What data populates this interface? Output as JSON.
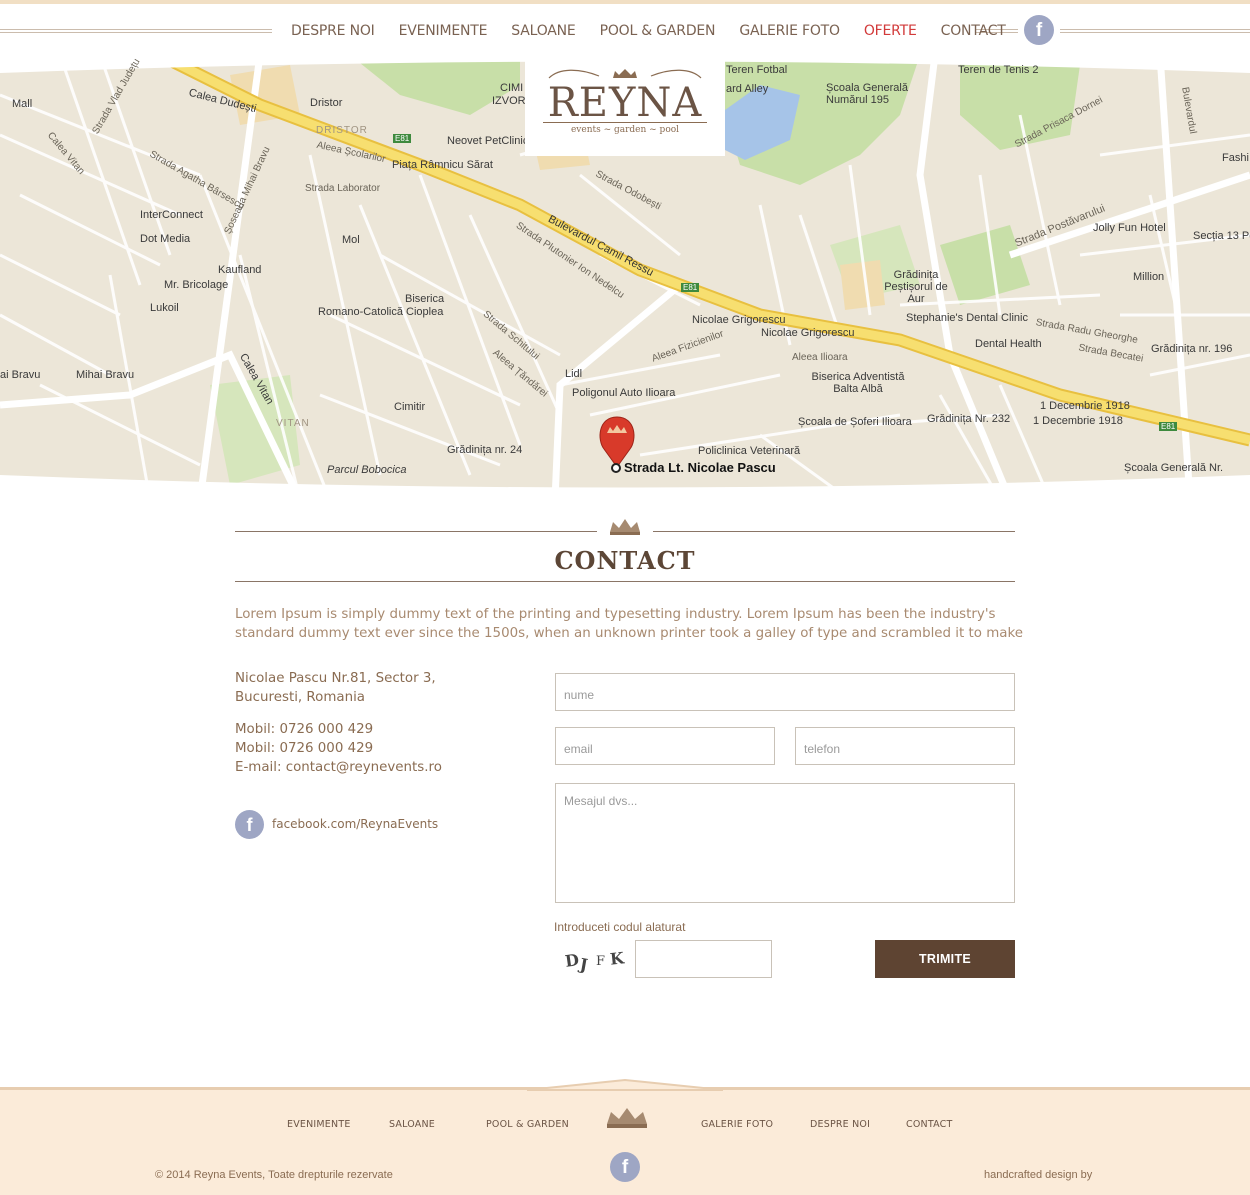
{
  "nav": {
    "items": [
      {
        "label": "DESPRE NOI",
        "active": false
      },
      {
        "label": "EVENIMENTE",
        "active": false
      },
      {
        "label": "SALOANE",
        "active": false
      },
      {
        "label": "POOL & GARDEN",
        "active": false
      },
      {
        "label": "GALERIE FOTO",
        "active": false
      },
      {
        "label": "OFERTE",
        "active": true
      },
      {
        "label": "CONTACT",
        "active": false
      }
    ],
    "facebook_icon": "facebook-icon",
    "facebook_glyph": "f"
  },
  "logo": {
    "name": "REYNA",
    "tagline": "events ~ garden ~ pool",
    "icon": "crown-icon"
  },
  "map": {
    "labels": [
      "Calea Dudești",
      "Dristor",
      "DRISTOR",
      "Neovet PetClinic",
      "Piața Râmnicu Sărat",
      "Aleea Școlarilor",
      "Strada Laborator",
      "InterConnect",
      "Dot Media",
      "Kaufland",
      "Mr. Bricolage",
      "Lukoil",
      "Mol",
      "Biserica",
      "Romano-Catolică Cioplea",
      "Mihai Bravu",
      "Calea Vitan",
      "VITAN",
      "Cimitir",
      "Parcul Bobocica",
      "Grădinița nr. 24",
      "Lidl",
      "Poligonul Auto Ilioara",
      "Policlinica Veterinară",
      "Școala de Șoferi Ilioara",
      "Strada Lt. Nicolae Pascu",
      "Nicolae Grigorescu",
      "Nicolae Grigorescu",
      "Bulevardul Camil Ressu",
      "Strada Odobești",
      "Strada Plutonier Ion Nedelcu",
      "Teren Fotbal",
      "ard Alley",
      "Școala Generală Numărul 195",
      "Teren de Tenis 2",
      "Strada Prisaca Dornei",
      "Jolly Fun Hotel",
      "Secția 13 Po",
      "Million",
      "Grădinița Peștișorul de Aur",
      "Stephanie's Dental Clinic",
      "Dental Health",
      "Grădinița nr. 196",
      "Biserica Adventistă Balta Albă",
      "Grădinița Nr. 232",
      "1 Decembrie 1918",
      "1 Decembrie 1918",
      "Școala Generală Nr.",
      "Strada Postăvarului",
      "Calea Vitan",
      "Mall",
      "Strada Vlad Județu",
      "E81",
      "E81",
      "E81",
      "CIMI",
      "IZVOR",
      "Fashi",
      "Aleea Ilioara",
      "Strada Becatei",
      "Strada Radu Gheorghe",
      "Bulevardul",
      "Strada Schitului",
      "Aleea Țăndărei",
      "Aleea Fizicienilor",
      "ai Bravu",
      "Strada Agatha Bârsescu",
      "Șoseaua Mihai Bravu"
    ],
    "pin_icon": "map-pin-crown-icon"
  },
  "contact": {
    "title": "CONTACT",
    "intro": "Lorem Ipsum is simply dummy text of the printing and typesetting industry. Lorem Ipsum has been the industry's standard dummy text ever since the 1500s, when an unknown printer took a galley of type and scrambled it to make",
    "address_line1": "Nicolae Pascu Nr.81, Sector 3,",
    "address_line2": "Bucuresti, Romania",
    "mobile1": "Mobil: 0726 000 429",
    "mobile2": "Mobil: 0726 000 429",
    "email": "E-mail: contact@reynevents.ro",
    "facebook": "facebook.com/ReynaEvents",
    "facebook_glyph": "f"
  },
  "form": {
    "name_placeholder": "nume",
    "email_placeholder": "email",
    "phone_placeholder": "telefon",
    "message_placeholder": "Mesajul dvs...",
    "captcha_label": "Introduceti codul alaturat",
    "captcha_chars": [
      "D",
      "J",
      "F",
      "K"
    ],
    "submit_label": "TRIMITE"
  },
  "footer": {
    "items": [
      "EVENIMENTE",
      "SALOANE",
      "POOL & GARDEN",
      "GALERIE FOTO",
      "DESPRE NOI",
      "CONTACT"
    ],
    "facebook_glyph": "f",
    "copyright": "© 2014 Reyna Events, Toate drepturile rezervate",
    "credit": "handcrafted design by"
  },
  "colors": {
    "brand_brown": "#5e4432",
    "active_nav": "#d23a3a",
    "facebook_blue": "#9ea6c4",
    "footer_bg": "#fbebd9"
  }
}
